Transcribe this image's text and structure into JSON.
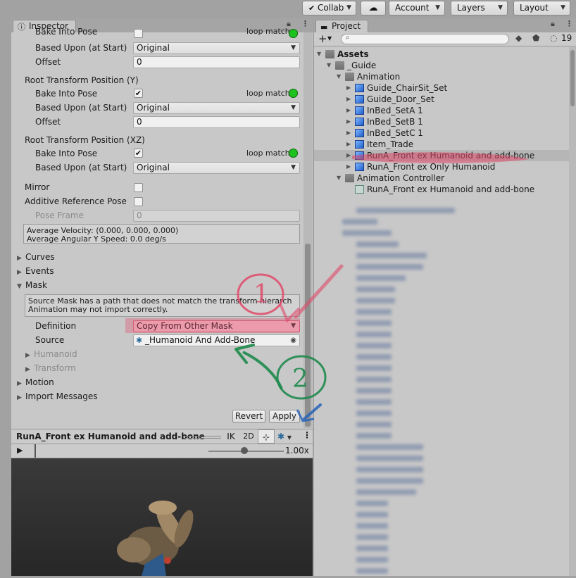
{
  "toolbar": {
    "collab": "Collab",
    "account": "Account",
    "layers": "Layers",
    "layout": "Layout"
  },
  "inspector": {
    "tab_title": "Inspector",
    "bake_into_pose": "Bake Into Pose",
    "loop_match": "loop match",
    "based_upon": "Based Upon (at Start)",
    "offset": "Offset",
    "original": "Original",
    "offset_value": "0",
    "root_pos_y": "Root Transform Position (Y)",
    "root_pos_xz": "Root Transform Position (XZ)",
    "mirror": "Mirror",
    "additive_pose": "Additive Reference Pose",
    "pose_frame": "Pose Frame",
    "pose_frame_value": "0",
    "avg_velocity": "Average Velocity: (0.000, 0.000, 0.000)",
    "avg_angular": "Average Angular Y Speed: 0.0 deg/s",
    "curves": "Curves",
    "events": "Events",
    "mask": "Mask",
    "mask_help_line1": "Source Mask has a path that does not match the transform hierarch",
    "mask_help_line2": "Animation may not import correctly.",
    "definition": "Definition",
    "definition_value": "Copy From Other Mask",
    "source": "Source",
    "source_value": "_Humanoid And Add-Bone",
    "humanoid": "Humanoid",
    "transform": "Transform",
    "motion": "Motion",
    "import_messages": "Import Messages",
    "revert": "Revert",
    "apply": "Apply"
  },
  "preview": {
    "title": "RunA_Front ex Humanoid and add-bone",
    "ik": "IK",
    "mode_2d": "2D",
    "speed": "1.00x"
  },
  "project": {
    "tab_title": "Project",
    "hidden_count": "19",
    "tree": [
      {
        "label": "Assets",
        "depth": 0,
        "type": "folder",
        "expanded": true,
        "bold": true
      },
      {
        "label": "_Guide",
        "depth": 1,
        "type": "folder",
        "expanded": true
      },
      {
        "label": "Animation",
        "depth": 2,
        "type": "folder",
        "expanded": true
      },
      {
        "label": "Guide_ChairSit_Set",
        "depth": 3,
        "type": "model",
        "expanded": false
      },
      {
        "label": "Guide_Door_Set",
        "depth": 3,
        "type": "model",
        "expanded": false
      },
      {
        "label": "InBed_SetA 1",
        "depth": 3,
        "type": "model",
        "expanded": false
      },
      {
        "label": "InBed_SetB 1",
        "depth": 3,
        "type": "model",
        "expanded": false
      },
      {
        "label": "InBed_SetC 1",
        "depth": 3,
        "type": "model",
        "expanded": false
      },
      {
        "label": "Item_Trade",
        "depth": 3,
        "type": "model",
        "expanded": false
      },
      {
        "label": "RunA_Front ex Humanoid and add-bone",
        "depth": 3,
        "type": "model",
        "expanded": false,
        "selected": true
      },
      {
        "label": "RunA_Front ex Only Humanoid",
        "depth": 3,
        "type": "model",
        "expanded": false
      },
      {
        "label": "Animation Controller",
        "depth": 2,
        "type": "folder",
        "expanded": true
      },
      {
        "label": "RunA_Front ex Humanoid and add-bone",
        "depth": 3,
        "type": "controller"
      }
    ]
  },
  "annotations": {
    "step1": "1",
    "step2": "2",
    "colors": {
      "red": "#e04a6a",
      "green": "#1f8a4c"
    }
  }
}
